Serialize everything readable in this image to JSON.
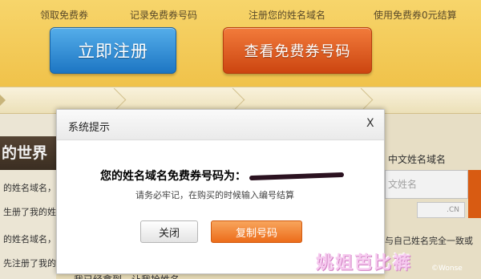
{
  "hero": {
    "register_label": "立即注册",
    "check_coupon_label": "查看免费券号码"
  },
  "steps": [
    {
      "label": "领取免费券"
    },
    {
      "label": "记录免费券号码"
    },
    {
      "label": "注册您的姓名域名"
    },
    {
      "label": "使用免费券0元结算"
    }
  ],
  "left": {
    "banner": "的世界",
    "lines": [
      "的姓名域名，",
      "生册了我的姓名",
      "的姓名域名，",
      "先注册了我的"
    ]
  },
  "right": {
    "label": "中文姓名域名",
    "input_placeholder": "文姓名",
    "suffix": ".CN",
    "agree": "与自己姓名完全一致或"
  },
  "dialog": {
    "title": "系统提示",
    "close_glyph": "X",
    "code_prefix": "您的姓名域名免费券号码为：",
    "note": "请务必牢记，在购买的时候输入编号结算",
    "close_button": "关闭",
    "copy_button": "复制号码"
  },
  "bottom": {
    "text": "我已经拿到，让我抢姓名"
  },
  "watermark": {
    "text": "姚姐芭比裤",
    "small": "©Wonse"
  }
}
